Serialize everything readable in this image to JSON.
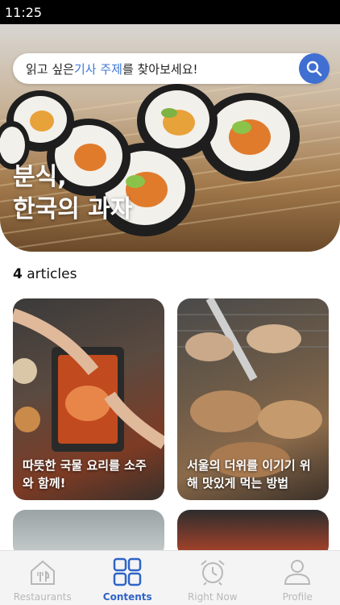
{
  "status": {
    "time": "11:25"
  },
  "search": {
    "prefix": "읽고 싶은 ",
    "highlight": "기사 주제",
    "suffix": "를 찾아보세요!"
  },
  "hero": {
    "title": "분식,\n한국의 과자"
  },
  "articles": {
    "count": "4",
    "count_label": " articles",
    "items": [
      {
        "title": "따뜻한 국물 요리를 소주와 함께!"
      },
      {
        "title": "서울의 더위를 이기기 위해 맛있게 먹는 방법"
      }
    ]
  },
  "tabs": [
    {
      "label": "Restaurants",
      "icon": "restaurant-icon",
      "active": false
    },
    {
      "label": "Contents",
      "icon": "grid-icon",
      "active": true
    },
    {
      "label": "Right Now",
      "icon": "alarm-clock-icon",
      "active": false
    },
    {
      "label": "Profile",
      "icon": "person-icon",
      "active": false
    }
  ],
  "colors": {
    "accent": "#2f63c7",
    "inactive": "#b8b8b8",
    "search_button": "#3f6fd1"
  }
}
